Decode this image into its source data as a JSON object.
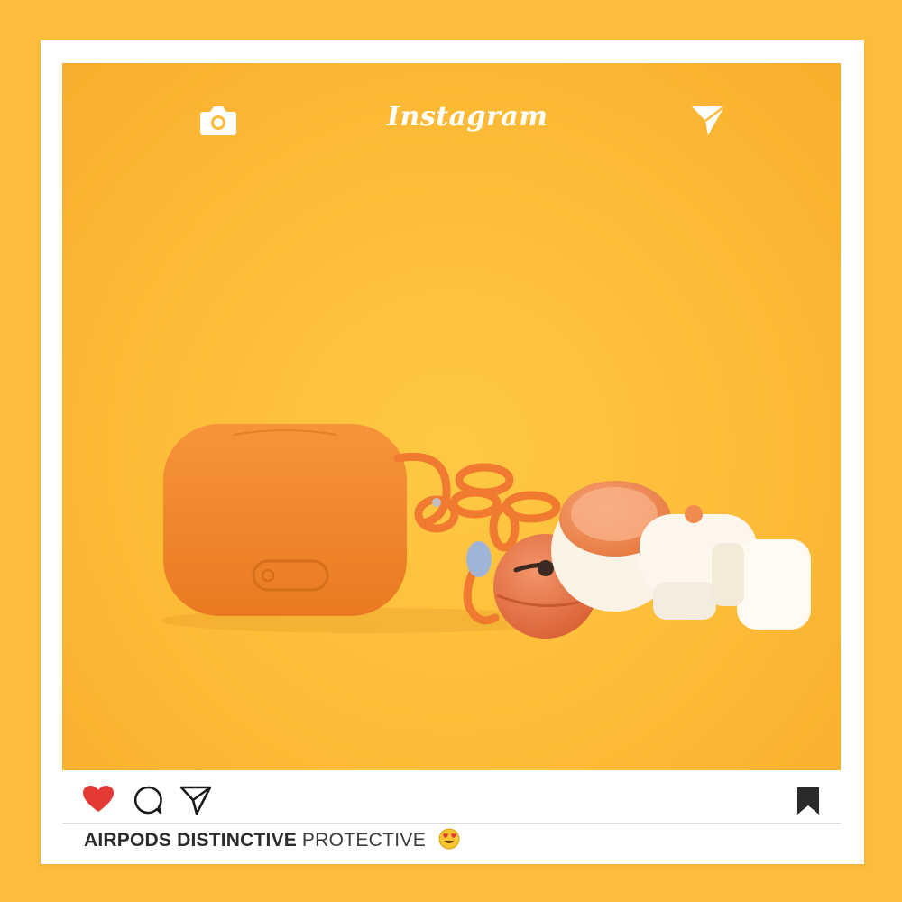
{
  "header": {
    "logo_text": "Instagram",
    "camera_icon": "camera-icon",
    "send_icon": "paper-plane-icon"
  },
  "photo": {
    "background_color": "#fdbd3c",
    "case_color": "#f28a2e",
    "figure_color": "#fbf3e6"
  },
  "actions": {
    "like_icon": "heart-icon",
    "like_color": "#e53935",
    "comment_icon": "comment-icon",
    "share_icon": "paper-plane-icon",
    "save_icon": "bookmark-icon"
  },
  "caption": {
    "bold_text": "AIRPODS DISTINCTIVE",
    "regular_text": "PROTECTIVE",
    "emoji": "heart-eyes-emoji"
  }
}
